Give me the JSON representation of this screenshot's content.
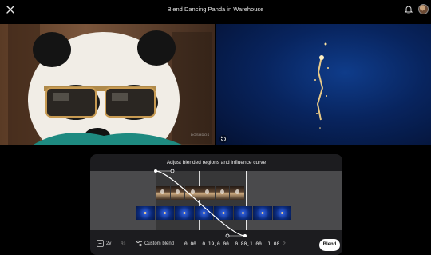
{
  "header": {
    "title": "Blend Dancing Panda in Warehouse"
  },
  "preview": {
    "watermark": "DOSHDOS"
  },
  "panel": {
    "title": "Adjust blended regions and influence curve",
    "length_option": "2v",
    "duration_option": "4s",
    "mode_label": "Custom blend",
    "curve_values": "0.00  0.19,0.00  0.80,1.00  1.00",
    "help_label": "?",
    "blend_button": "Blend"
  },
  "icons": {
    "close": "close-icon",
    "notifications": "bell-icon",
    "reset": "reset-icon",
    "length": "length-icon",
    "mode": "sliders-icon"
  }
}
